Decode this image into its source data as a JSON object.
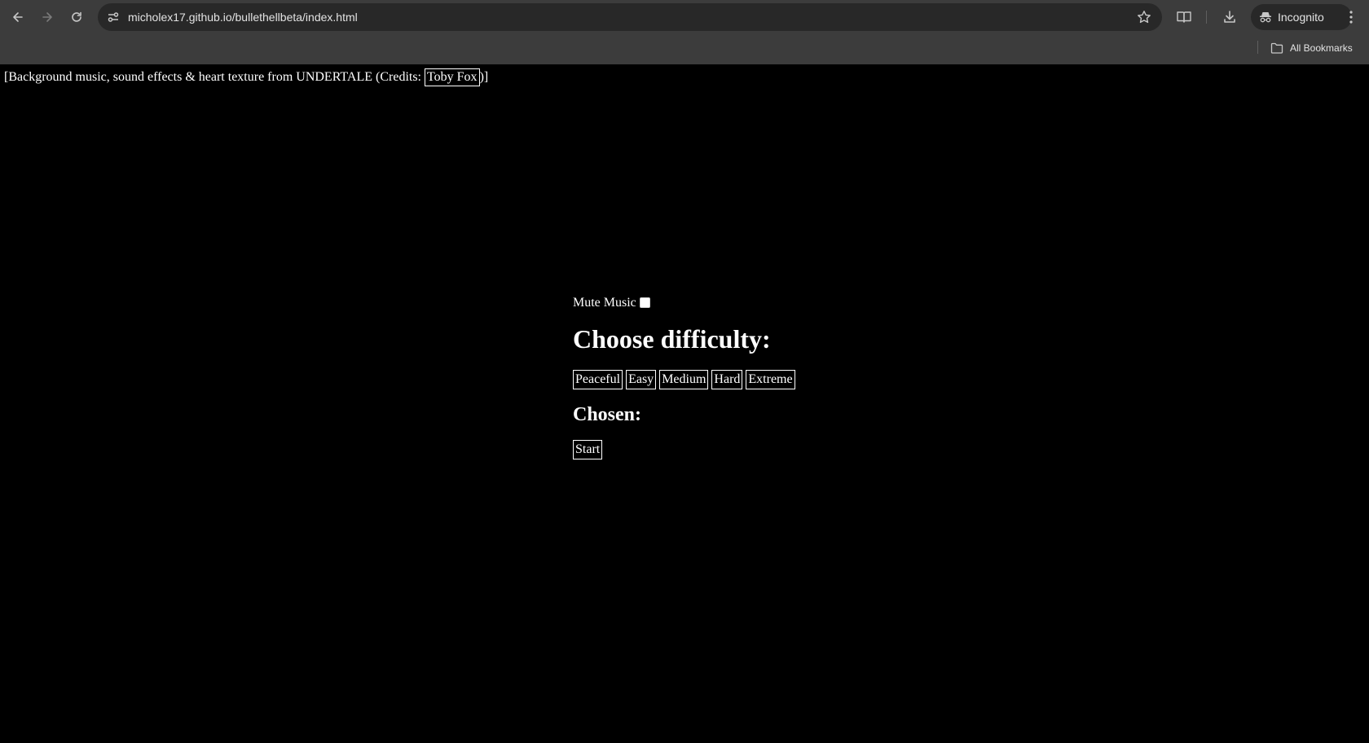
{
  "browser": {
    "url": "micholex17.github.io/bullethellbeta/index.html",
    "incognito_label": "Incognito",
    "all_bookmarks_label": "All Bookmarks"
  },
  "page": {
    "credits_prefix": "[Background music, sound effects & heart texture from UNDERTALE (Credits: ",
    "credits_link": "Toby Fox",
    "credits_suffix": ")]",
    "mute_label": "Mute Music",
    "mute_checked": false,
    "difficulty_heading": "Choose difficulty:",
    "difficulties": [
      "Peaceful",
      "Easy",
      "Medium",
      "Hard",
      "Extreme"
    ],
    "chosen_label": "Chosen:",
    "start_label": "Start"
  }
}
